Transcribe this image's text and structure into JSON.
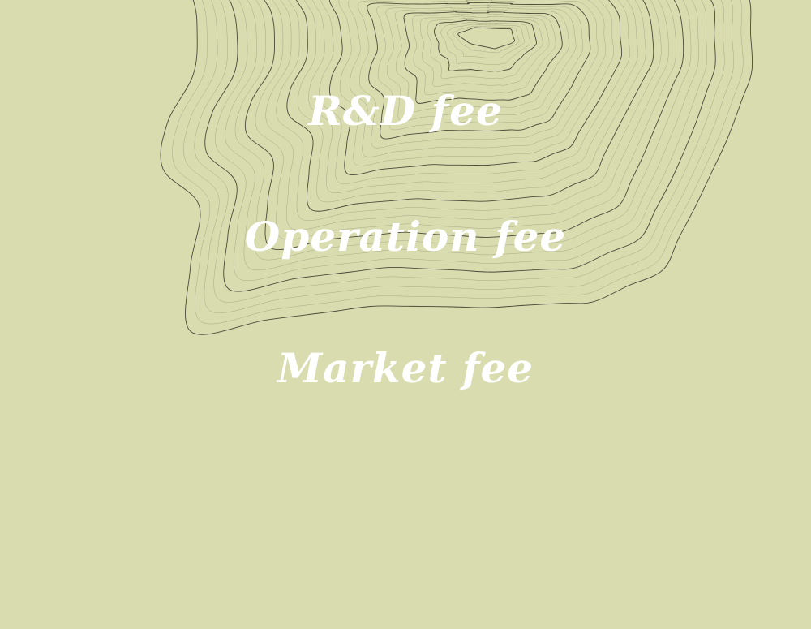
{
  "labels": {
    "rnd": "R&D fee",
    "operation": "Operation fee",
    "market": "Market fee"
  },
  "colors": {
    "background": "#d8dcae",
    "text": "#ffffff",
    "contour_dark": "#3a3a2e",
    "contour_light": "#8a8c70"
  },
  "decoration": {
    "type": "topographic-contour-lines"
  }
}
